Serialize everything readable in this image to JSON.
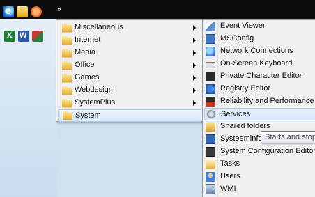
{
  "overflow_chevron": "»",
  "quick_launch_row1": [
    "internet-explorer-icon",
    "folder-favorites-icon",
    "media-player-icon"
  ],
  "quick_launch_row2": [
    "excel-icon",
    "word-icon",
    "access-icon"
  ],
  "programs_menu": {
    "items": [
      {
        "label": "Miscellaneous",
        "has_submenu": true
      },
      {
        "label": "Internet",
        "has_submenu": true
      },
      {
        "label": "Media",
        "has_submenu": true
      },
      {
        "label": "Office",
        "has_submenu": true
      },
      {
        "label": "Games",
        "has_submenu": true
      },
      {
        "label": "Webdesign",
        "has_submenu": true
      },
      {
        "label": "SystemPlus",
        "has_submenu": true
      },
      {
        "label": "System",
        "has_submenu": false,
        "selected": true
      }
    ]
  },
  "system_menu": {
    "items": [
      {
        "label": "Event Viewer",
        "icon": "event-viewer-icon"
      },
      {
        "label": "MSConfig",
        "icon": "msconfig-icon"
      },
      {
        "label": "Network Connections",
        "icon": "network-connections-icon"
      },
      {
        "label": "On-Screen Keyboard",
        "icon": "keyboard-icon"
      },
      {
        "label": "Private Character Editor",
        "icon": "character-editor-icon"
      },
      {
        "label": "Registry Editor",
        "icon": "registry-editor-icon"
      },
      {
        "label": "Reliability and Performance",
        "icon": "reliability-icon"
      },
      {
        "label": "Services",
        "icon": "services-gear-icon",
        "selected": true
      },
      {
        "label": "Shared folders",
        "icon": "shared-folders-icon"
      },
      {
        "label": "Systeeminfo",
        "icon": "system-info-icon"
      },
      {
        "label": "System Configuration Editor",
        "icon": "config-editor-icon"
      },
      {
        "label": "Tasks",
        "icon": "tasks-icon"
      },
      {
        "label": "Users",
        "icon": "users-icon"
      },
      {
        "label": "WMI",
        "icon": "wmi-icon"
      }
    ]
  },
  "tooltip": {
    "text": "Starts and stop"
  }
}
